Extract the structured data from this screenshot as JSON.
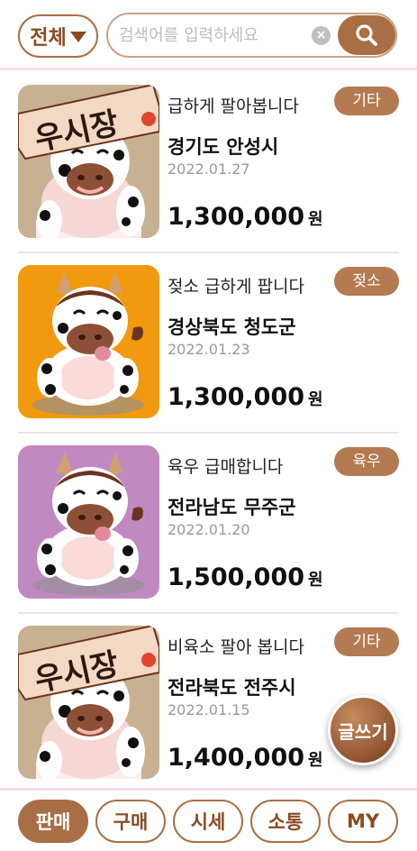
{
  "header": {
    "filter_label": "전체",
    "search_placeholder": "검색어를 입력하세요"
  },
  "colors": {
    "accent": "#a86f45",
    "badge": "#b47a52",
    "divider": "#f4dfe4"
  },
  "listings": [
    {
      "title": "급하게 팔아봅니다",
      "category": "기타",
      "region": "경기도 안성시",
      "date": "2022.01.27",
      "price": "1,300,000",
      "unit": "원",
      "thumb": "sign-cow"
    },
    {
      "title": "젖소 급하게 팝니다",
      "category": "젖소",
      "region": "경상북도 청도군",
      "date": "2022.01.23",
      "price": "1,300,000",
      "unit": "원",
      "thumb": "cow-orange"
    },
    {
      "title": "육우 급매합니다",
      "category": "육우",
      "region": "전라남도 무주군",
      "date": "2022.01.20",
      "price": "1,500,000",
      "unit": "원",
      "thumb": "cow-purple"
    },
    {
      "title": "비육소 팔아 봅니다",
      "category": "기타",
      "region": "전라북도 전주시",
      "date": "2022.01.15",
      "price": "1,400,000",
      "unit": "원",
      "thumb": "sign-cow"
    }
  ],
  "sign_text": "우시장",
  "write_button": "글쓰기",
  "tabs": [
    "판매",
    "구매",
    "시세",
    "소통",
    "MY"
  ]
}
